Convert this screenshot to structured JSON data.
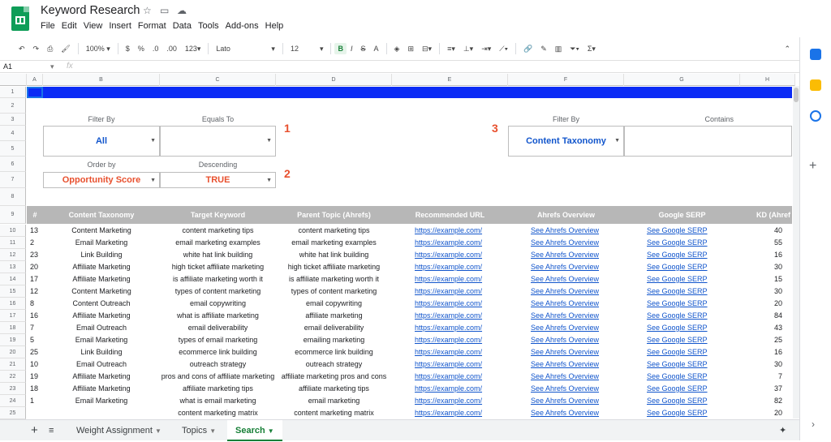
{
  "app": {
    "doc_title": "Keyword Research",
    "menu": [
      "File",
      "Edit",
      "View",
      "Insert",
      "Format",
      "Data",
      "Tools",
      "Add-ons",
      "Help"
    ]
  },
  "toolbar": {
    "zoom": "100%",
    "currency": "$",
    "percent": "%",
    "dec_decrease": ".0",
    "dec_increase": ".00",
    "format_more": "123",
    "font": "Lato",
    "font_size": "12",
    "bold": "B",
    "italic": "I",
    "strike": "S",
    "text_color": "A"
  },
  "formula_bar": {
    "cell_ref": "A1",
    "fx": "fx",
    "value": ""
  },
  "columns": [
    "A",
    "B",
    "C",
    "D",
    "E",
    "F",
    "G",
    "H"
  ],
  "rows": [
    "1",
    "2",
    "3",
    "4",
    "5",
    "6",
    "7",
    "8",
    "9",
    "10",
    "11",
    "12",
    "13",
    "14",
    "15",
    "16",
    "17",
    "18",
    "19",
    "20",
    "21",
    "22",
    "23",
    "24",
    "25"
  ],
  "filters": {
    "filter_by_label": "Filter By",
    "filter_by_value": "All",
    "equals_to_label": "Equals To",
    "equals_to_value": "",
    "order_by_label": "Order by",
    "order_by_value": "Opportunity Score",
    "descending_label": "Descending",
    "descending_value": "TRUE",
    "step1": "1",
    "step2": "2",
    "step3": "3",
    "filter_by2_label": "Filter By",
    "filter_by2_value": "Content Taxonomy",
    "contains_label": "Contains",
    "contains_value": ""
  },
  "table": {
    "headers": [
      "#",
      "Content Taxonomy",
      "Target Keyword",
      "Parent Topic (Ahrefs)",
      "Recommended URL",
      "Ahrefs Overview",
      "Google SERP",
      "KD (Ahref"
    ],
    "rows": [
      [
        "13",
        "Content Marketing",
        "content marketing tips",
        "content marketing tips",
        "https://example.com/",
        "See Ahrefs Overview",
        "See Google SERP",
        "40"
      ],
      [
        "2",
        "Email Marketing",
        "email marketing examples",
        "email marketing examples",
        "https://example.com/",
        "See Ahrefs Overview",
        "See Google SERP",
        "55"
      ],
      [
        "23",
        "Link Building",
        "white hat link building",
        "white hat link building",
        "https://example.com/",
        "See Ahrefs Overview",
        "See Google SERP",
        "16"
      ],
      [
        "20",
        "Affiliate Marketing",
        "high ticket affiliate marketing",
        "high ticket affiliate marketing",
        "https://example.com/",
        "See Ahrefs Overview",
        "See Google SERP",
        "30"
      ],
      [
        "17",
        "Affiliate Marketing",
        "is affiliate marketing worth it",
        "is affiliate marketing worth it",
        "https://example.com/",
        "See Ahrefs Overview",
        "See Google SERP",
        "15"
      ],
      [
        "12",
        "Content Marketing",
        "types of content marketing",
        "types of content marketing",
        "https://example.com/",
        "See Ahrefs Overview",
        "See Google SERP",
        "30"
      ],
      [
        "8",
        "Content Outreach",
        "email copywriting",
        "email copywriting",
        "https://example.com/",
        "See Ahrefs Overview",
        "See Google SERP",
        "20"
      ],
      [
        "16",
        "Affiliate Marketing",
        "what is affiliate marketing",
        "affiliate marketing",
        "https://example.com/",
        "See Ahrefs Overview",
        "See Google SERP",
        "84"
      ],
      [
        "7",
        "Email Outreach",
        "email deliverability",
        "email deliverability",
        "https://example.com/",
        "See Ahrefs Overview",
        "See Google SERP",
        "43"
      ],
      [
        "5",
        "Email Marketing",
        "types of email marketing",
        "emailing marketing",
        "https://example.com/",
        "See Ahrefs Overview",
        "See Google SERP",
        "25"
      ],
      [
        "25",
        "Link Building",
        "ecommerce link building",
        "ecommerce link building",
        "https://example.com/",
        "See Ahrefs Overview",
        "See Google SERP",
        "16"
      ],
      [
        "10",
        "Email Outreach",
        "outreach strategy",
        "outreach strategy",
        "https://example.com/",
        "See Ahrefs Overview",
        "See Google SERP",
        "30"
      ],
      [
        "19",
        "Affiliate Marketing",
        "pros and cons of affiliate marketing",
        "affiliate marketing pros and cons",
        "https://example.com/",
        "See Ahrefs Overview",
        "See Google SERP",
        "7"
      ],
      [
        "18",
        "Affiliate Marketing",
        "affiliate marketing tips",
        "affiliate marketing tips",
        "https://example.com/",
        "See Ahrefs Overview",
        "See Google SERP",
        "37"
      ],
      [
        "1",
        "Email Marketing",
        "what is email marketing",
        "email marketing",
        "https://example.com/",
        "See Ahrefs Overview",
        "See Google SERP",
        "82"
      ],
      [
        "",
        "",
        "content marketing matrix",
        "content marketing matrix",
        "https://example.com/",
        "See Ahrefs Overview",
        "See Google SERP",
        "20"
      ]
    ]
  },
  "sheet_tabs": [
    "Weight Assignment",
    "Topics",
    "Search"
  ],
  "active_tab": "Search",
  "colors": {
    "header_bar": "#0b2bf5",
    "table_header": "#b7b7b7",
    "accent_red": "#e8502e",
    "link": "#1155cc"
  }
}
